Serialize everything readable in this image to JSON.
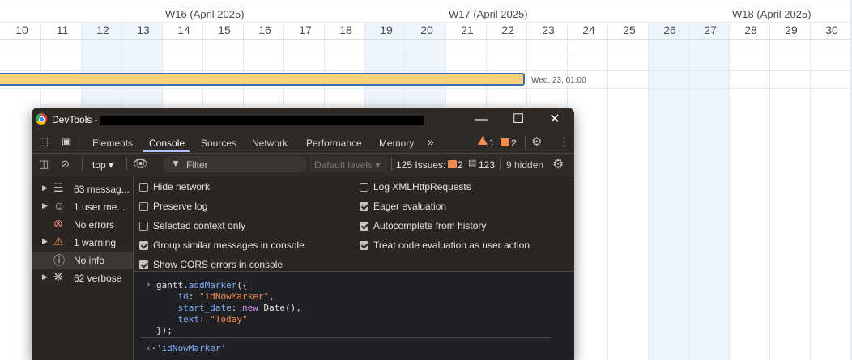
{
  "gantt": {
    "weeks": [
      "W16 (April 2025)",
      "W17 (April 2025)",
      "W18 (April 2025)"
    ],
    "days": [
      "10",
      "11",
      "12",
      "13",
      "14",
      "15",
      "16",
      "17",
      "18",
      "19",
      "20",
      "21",
      "22",
      "23",
      "24",
      "25",
      "26",
      "27",
      "28",
      "29",
      "30"
    ],
    "task_end_label": "Wed. 23, 01:00",
    "task_color": "#f9d27a",
    "task_border_color": "#3d6fb8"
  },
  "devtools": {
    "title": "DevTools -",
    "tabs": [
      "Elements",
      "Console",
      "Sources",
      "Network",
      "Performance",
      "Memory"
    ],
    "active_tab": "Console",
    "more_tabs_icon": "double-chevron-right-icon",
    "warnings_count": "1",
    "issues_count": "2",
    "toolbar": {
      "context": "top ▾",
      "filter_placeholder": "Filter",
      "levels": "Default levels ▾",
      "issues_label": "125 Issues:",
      "issues_errors": "2",
      "issues_info": "123",
      "hidden": "9 hidden"
    },
    "sidebar": [
      {
        "icon": "list-icon",
        "label": "63 messag...",
        "expandable": true
      },
      {
        "icon": "user-icon",
        "label": "1 user me...",
        "expandable": true
      },
      {
        "icon": "error-icon",
        "label": "No errors",
        "expandable": false
      },
      {
        "icon": "warning-icon",
        "label": "1 warning",
        "expandable": true
      },
      {
        "icon": "info-icon",
        "label": "No info",
        "expandable": false
      },
      {
        "icon": "bug-icon",
        "label": "62 verbose",
        "expandable": true
      }
    ],
    "settings_left": [
      {
        "label": "Hide network",
        "checked": false
      },
      {
        "label": "Preserve log",
        "checked": false
      },
      {
        "label": "Selected context only",
        "checked": false
      },
      {
        "label": "Group similar messages in console",
        "checked": true
      },
      {
        "label": "Show CORS errors in console",
        "checked": true
      }
    ],
    "settings_right": [
      {
        "label": "Log XMLHttpRequests",
        "checked": false
      },
      {
        "label": "Eager evaluation",
        "checked": true
      },
      {
        "label": "Autocomplete from history",
        "checked": true
      },
      {
        "label": "Treat code evaluation as user action",
        "checked": true
      }
    ],
    "console": {
      "code": {
        "line1_obj": "gantt.",
        "line1_fn": "addMarker",
        "line1_end": "({",
        "id_key": "id",
        "id_val": "\"idNowMarker\"",
        "start_key": "start_date",
        "start_new": "new",
        "start_fn": " Date(),",
        "text_key": "text",
        "text_val": "\"Today\"",
        "close": "});"
      },
      "result": "'idNowMarker'"
    }
  }
}
